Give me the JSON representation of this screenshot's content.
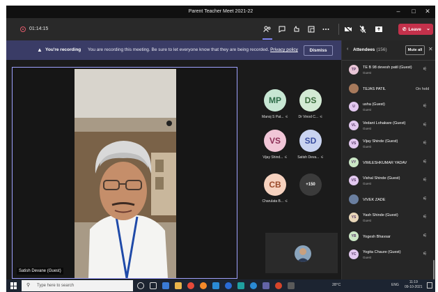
{
  "window": {
    "title": "Parent Teacher Meet 2021-22"
  },
  "toolbar": {
    "timer": "01:14:15",
    "leave_label": "Leave"
  },
  "banner": {
    "bold": "You're recording",
    "message": "You are recording this meeting. Be sure to let everyone know that they are being recorded.",
    "link": "Privacy policy",
    "dismiss_label": "Dismiss"
  },
  "stage": {
    "speaker_name": "Satish Devane (Guest)",
    "tiles": [
      {
        "initials": "MP",
        "name": "Manoj S Pat...",
        "color": "#c7e6d3"
      },
      {
        "initials": "DS",
        "name": "Dr Vinod C...",
        "color": "#d3ead4"
      },
      {
        "initials": "VS",
        "name": "Vijay Shind...",
        "color": "#f1c6d7"
      },
      {
        "initials": "SD",
        "name": "Satish Deva...",
        "color": "#c9d3f0"
      },
      {
        "initials": "CB",
        "name": "Charulata B...",
        "color": "#f6d2bf"
      }
    ],
    "more_count": "+150"
  },
  "panel": {
    "title": "Attendees",
    "count": "(156)",
    "mute_all_label": "Mute all",
    "attendees": [
      {
        "initials": "TP",
        "name": "TE B 98 devesh patil (Guest)",
        "sub": "Guest",
        "status": "mic",
        "color": "#e8c5d6"
      },
      {
        "initials": "",
        "name": "TEJAS PATIL",
        "sub": "",
        "status": "hold",
        "status_text": "On hold",
        "color": "#a87a5c"
      },
      {
        "initials": "U",
        "name": "usha (Guest)",
        "sub": "Guest",
        "status": "mic",
        "color": "#e2c8ef"
      },
      {
        "initials": "VL",
        "name": "Vedant Lohakare (Guest)",
        "sub": "Guest",
        "status": "mic",
        "color": "#e2c8ef"
      },
      {
        "initials": "VS",
        "name": "Vijay Shinde (Guest)",
        "sub": "Guest",
        "status": "mic",
        "color": "#e2c8ef"
      },
      {
        "initials": "VY",
        "name": "VIMLESHKUMAR YADAV",
        "sub": "",
        "status": "mic",
        "color": "#cbe7c6"
      },
      {
        "initials": "VS",
        "name": "Vishal Shinde (Guest)",
        "sub": "Guest",
        "status": "mic",
        "color": "#e2c8ef"
      },
      {
        "initials": "",
        "name": "VIVEK ZADE",
        "sub": "",
        "status": "mic",
        "color": "#6a7fa0"
      },
      {
        "initials": "YS",
        "name": "Yash Shinde (Guest)",
        "sub": "Guest",
        "status": "mic",
        "color": "#e8d6b8"
      },
      {
        "initials": "YB",
        "name": "Yogesh Bhavsar",
        "sub": "",
        "status": "mic",
        "color": "#cbe7c6"
      },
      {
        "initials": "YC",
        "name": "Yogita Chaure (Guest)",
        "sub": "Guest",
        "status": "mic",
        "color": "#e2c8ef"
      }
    ]
  },
  "taskbar": {
    "search_placeholder": "Type here to search",
    "temperature": "28°C",
    "language": "ENG",
    "time": "11:19",
    "date": "09-10-2021"
  },
  "colors": {
    "accent": "#7f85f5",
    "leave": "#c4314b",
    "banner": "#3a3c66"
  }
}
